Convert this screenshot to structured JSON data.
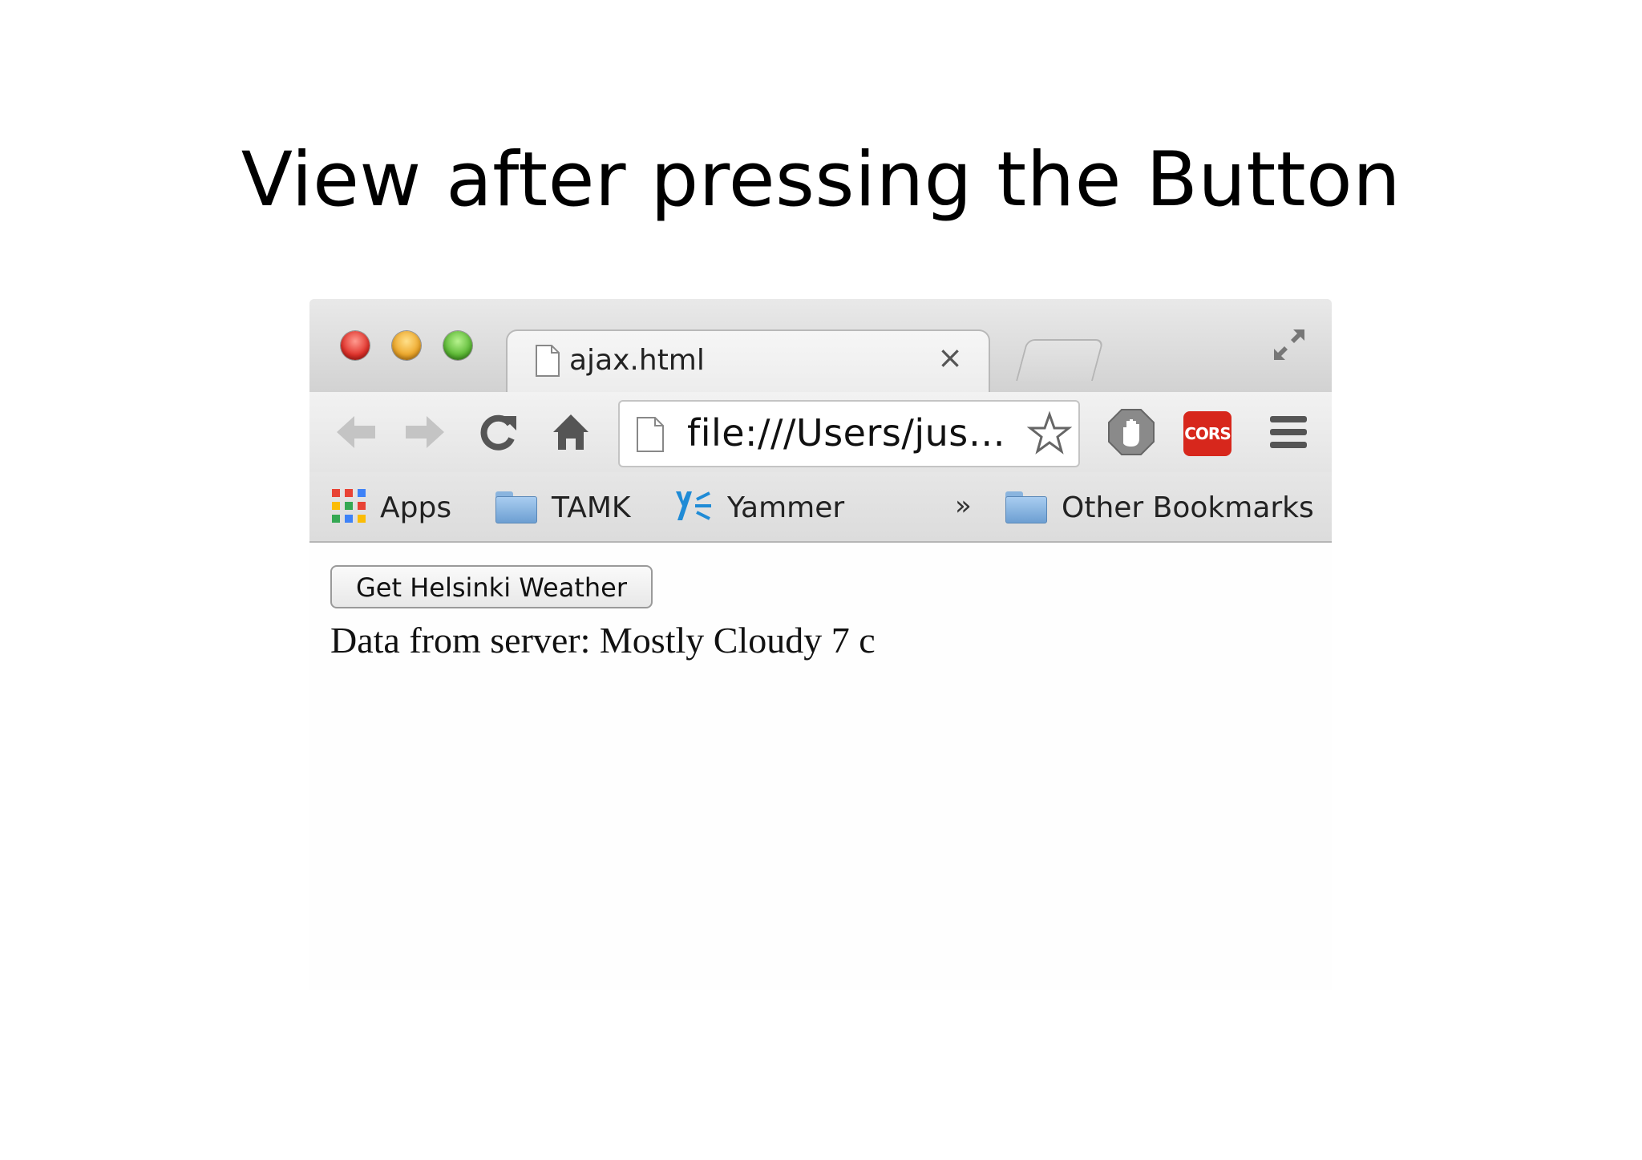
{
  "slide": {
    "title": "View after pressing the Button"
  },
  "browser": {
    "tab": {
      "title": "ajax.html",
      "close": "×"
    },
    "address": {
      "url": "file:///Users/jus…"
    },
    "extensions": {
      "cors_label": "CORS"
    },
    "bookmarks": {
      "items": [
        {
          "label": "Apps",
          "icon": "apps-grid-icon"
        },
        {
          "label": "TAMK",
          "icon": "folder-icon"
        },
        {
          "label": "Yammer",
          "icon": "yammer-icon"
        }
      ],
      "overflow": "»",
      "other": "Other Bookmarks"
    }
  },
  "page": {
    "button_label": "Get Helsinki Weather",
    "result_text": "Data from server: Mostly Cloudy 7 c"
  },
  "colors": {
    "cors_red": "#d7271c",
    "yammer_blue": "#1f8bd6",
    "folder_blue": "#8ab4de"
  }
}
